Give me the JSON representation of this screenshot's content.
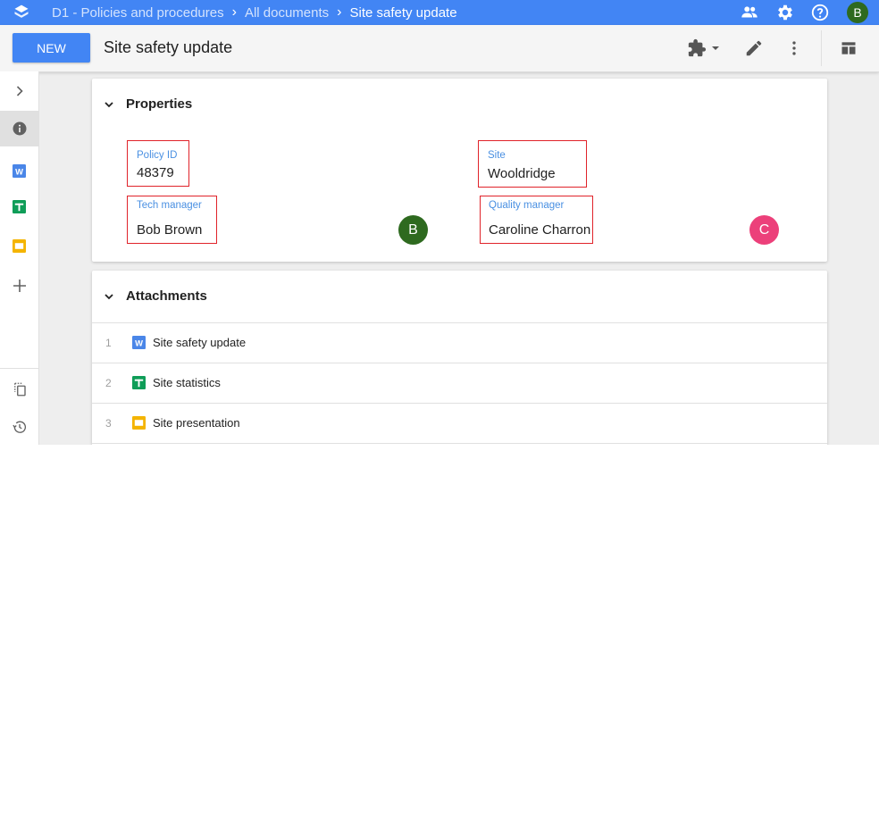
{
  "breadcrumb": [
    {
      "label": "D1 - Policies and procedures"
    },
    {
      "label": "All documents"
    },
    {
      "label": "Site safety update"
    }
  ],
  "user_initial": "B",
  "toolbar": {
    "new_label": "NEW",
    "doc_title": "Site safety update"
  },
  "properties": {
    "title": "Properties",
    "policy_id_label": "Policy ID",
    "policy_id_value": "48379",
    "site_label": "Site",
    "site_value": "Wooldridge",
    "tech_manager_label": "Tech manager",
    "tech_manager_value": "Bob Brown",
    "tech_manager_initial": "B",
    "quality_manager_label": "Quality manager",
    "quality_manager_value": "Caroline Charron",
    "quality_manager_initial": "C"
  },
  "attachments": {
    "title": "Attachments",
    "items": [
      {
        "num": "1",
        "name": "Site safety update",
        "type": "doc-icon"
      },
      {
        "num": "2",
        "name": "Site statistics",
        "type": "sheet-icon"
      },
      {
        "num": "3",
        "name": "Site presentation",
        "type": "slides-icon"
      }
    ]
  },
  "colors": {
    "accent": "#4285f4",
    "doc": "#4a86e8",
    "sheet": "#0f9d58",
    "slides": "#f4b400",
    "avatar_b": "#2e6a1f",
    "avatar_c": "#ec407a",
    "highlight_box": "#e0232a"
  }
}
